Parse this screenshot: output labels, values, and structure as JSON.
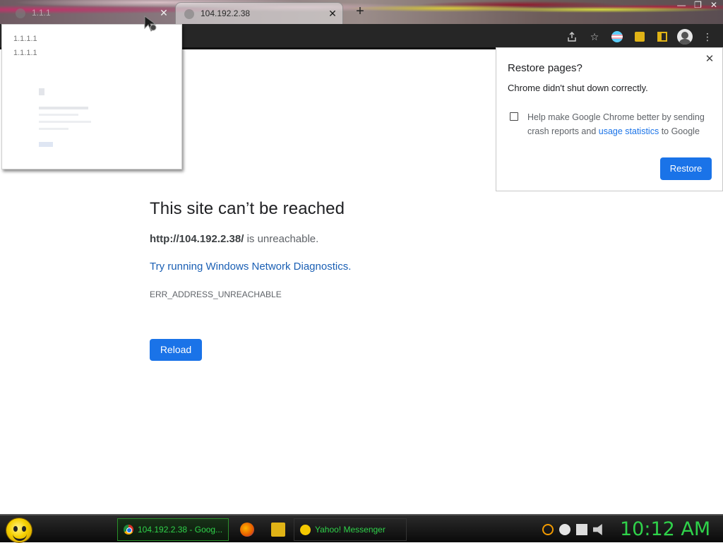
{
  "browser": {
    "background_tab": {
      "title": "1.1.1"
    },
    "active_tab": {
      "title": "104.192.2.38"
    },
    "new_tab_symbol": "+",
    "window_controls": {
      "minimize": "—",
      "restore": "❐",
      "close": "✕"
    }
  },
  "hover_preview": {
    "line1": "1.1.1.1",
    "line2": "1.1.1.1"
  },
  "error_page": {
    "title": "This site can’t be reached",
    "url": "http://104.192.2.38/",
    "unreachable_text": " is unreachable.",
    "diagnostics_link": "Try running Windows Network Diagnostics",
    "diagnostics_period": ".",
    "error_code": "ERR_ADDRESS_UNREACHABLE",
    "reload_label": "Reload"
  },
  "restore_bubble": {
    "title": "Restore pages?",
    "subtitle": "Chrome didn't shut down correctly.",
    "checkbox_text_before": "Help make Google Chrome better by sending crash reports and ",
    "checkbox_link": "usage statistics",
    "checkbox_text_after": " to Google",
    "restore_label": "Restore",
    "checked": false
  },
  "taskbar": {
    "chrome_task": "104.192.2.38 - Goog...",
    "yahoo_task": "Yahoo! Messenger",
    "clock": "10:12 AM"
  },
  "colors": {
    "accent_blue": "#1a73e8",
    "taskbar_green": "#2fd24a",
    "toolbar_dark": "#262626"
  },
  "icons": [
    "share-icon",
    "bookmark-star-icon",
    "extension-flag-icon",
    "extensions-puzzle-icon",
    "side-panel-icon",
    "profile-avatar-icon",
    "menu-kebab-icon",
    "close-icon",
    "mouse-cursor-icon",
    "start-smiley-icon",
    "firefox-icon",
    "folder-icon",
    "search-icon",
    "messenger-tray-icon",
    "network-icon",
    "volume-icon"
  ]
}
